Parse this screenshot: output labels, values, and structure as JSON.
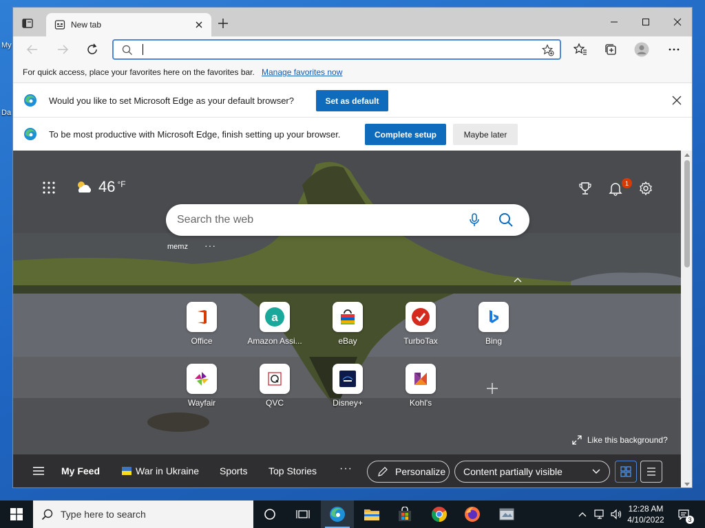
{
  "desktop": {
    "icon_labels": [
      "My",
      "Da"
    ]
  },
  "browser": {
    "tab": {
      "title": "New tab"
    },
    "address_bar": {
      "value": "",
      "placeholder": ""
    },
    "favorites_bar": {
      "text": "For quick access, place your favorites here on the favorites bar.",
      "link": "Manage favorites now"
    },
    "infobars": [
      {
        "text": "Would you like to set Microsoft Edge as your default browser?",
        "primary": "Set as default"
      },
      {
        "text": "To be most productive with Microsoft Edge, finish setting up your browser.",
        "primary": "Complete setup",
        "secondary": "Maybe later"
      }
    ]
  },
  "ntp": {
    "weather": {
      "temp": "46",
      "unit": "°F"
    },
    "notification_count": "1",
    "search": {
      "placeholder": "Search the web"
    },
    "quicklinks_label": "memz",
    "more": "···",
    "tiles": [
      {
        "label": "Office",
        "icon": "office-icon"
      },
      {
        "label": "Amazon Assi...",
        "icon": "amazon-icon"
      },
      {
        "label": "eBay",
        "icon": "ebay-icon"
      },
      {
        "label": "TurboTax",
        "icon": "turbotax-icon"
      },
      {
        "label": "Bing",
        "icon": "bing-icon"
      },
      {
        "label": "Wayfair",
        "icon": "wayfair-icon"
      },
      {
        "label": "QVC",
        "icon": "qvc-icon"
      },
      {
        "label": "Disney+",
        "icon": "disney-icon"
      },
      {
        "label": "Kohl's",
        "icon": "kohls-icon"
      }
    ],
    "like_background": "Like this background?",
    "feed": {
      "my_feed": "My Feed",
      "items": [
        "War in Ukraine",
        "Sports",
        "Top Stories"
      ],
      "more": "···",
      "personalize": "Personalize",
      "content_visibility": "Content partially visible"
    }
  },
  "taskbar": {
    "search_placeholder": "Type here to search",
    "time": "12:28 AM",
    "date": "4/10/2022",
    "notification_count": "3"
  },
  "colors": {
    "accent": "#0f6cbd",
    "address_focus": "#4e86d8",
    "badge": "#d83b01",
    "taskbar": "#101820"
  }
}
